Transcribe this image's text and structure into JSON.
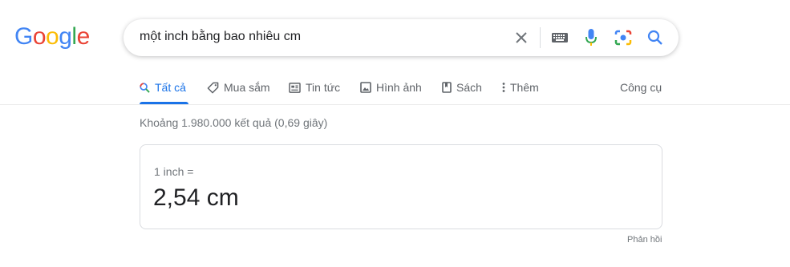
{
  "logo": {
    "letters": [
      "G",
      "o",
      "o",
      "g",
      "l",
      "e"
    ],
    "colors": [
      "#4285F4",
      "#EA4335",
      "#FBBC05",
      "#4285F4",
      "#34A853",
      "#EA4335"
    ]
  },
  "search": {
    "query": "một inch bằng bao nhiêu cm",
    "icons": [
      "clear-icon",
      "keyboard-icon",
      "mic-icon",
      "camera-icon",
      "search-icon"
    ]
  },
  "tabs": [
    {
      "label": "Tất cả",
      "icon": "search-icon",
      "active": true
    },
    {
      "label": "Mua sắm",
      "icon": "tag-icon",
      "active": false
    },
    {
      "label": "Tin tức",
      "icon": "news-icon",
      "active": false
    },
    {
      "label": "Hình ảnh",
      "icon": "image-icon",
      "active": false
    },
    {
      "label": "Sách",
      "icon": "book-icon",
      "active": false
    },
    {
      "label": "Thêm",
      "icon": "more-vert-icon",
      "active": false
    }
  ],
  "tools_label": "Công cụ",
  "result_stats": "Khoảng 1.980.000 kết quả (0,69 giây)",
  "converter": {
    "from_text": "1 inch =",
    "result_text": "2,54 cm"
  },
  "feedback_label": "Phản hồi",
  "colors": {
    "accent": "#1a73e8",
    "muted": "#70757a",
    "tab_text": "#5f6368"
  }
}
